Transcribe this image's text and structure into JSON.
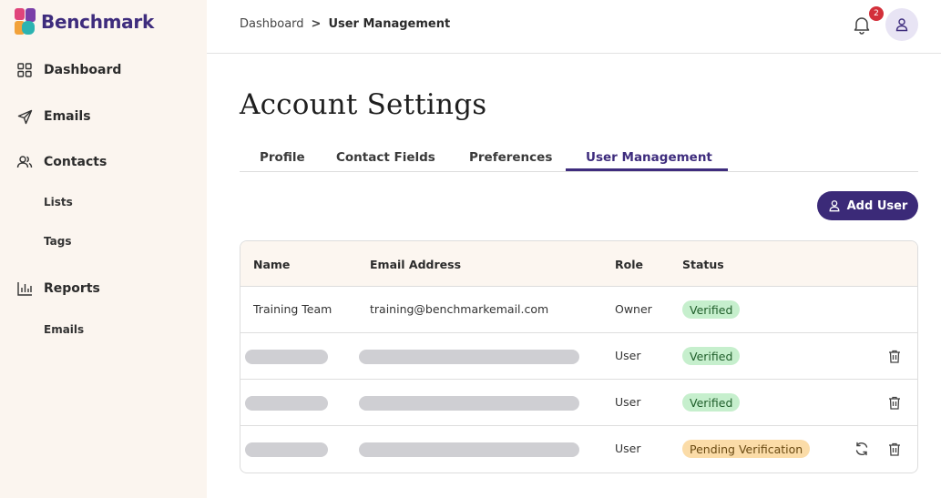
{
  "brand": {
    "name": "Benchmark"
  },
  "sidebar": {
    "items": [
      {
        "label": "Dashboard",
        "icon": "grid-icon"
      },
      {
        "label": "Emails",
        "icon": "send-icon"
      },
      {
        "label": "Contacts",
        "icon": "users-icon"
      },
      {
        "label": "Lists"
      },
      {
        "label": "Tags"
      },
      {
        "label": "Reports",
        "icon": "bar-chart-icon"
      },
      {
        "label": "Emails"
      }
    ]
  },
  "header": {
    "breadcrumb": {
      "parent": "Dashboard",
      "separator": ">",
      "current": "User Management"
    },
    "notifications_count": "2"
  },
  "main": {
    "title": "Account Settings",
    "tabs": [
      {
        "label": "Profile"
      },
      {
        "label": "Contact Fields"
      },
      {
        "label": "Preferences"
      },
      {
        "label": "User Management",
        "active": true
      }
    ],
    "add_user_label": "Add User",
    "table": {
      "columns": [
        "Name",
        "Email Address",
        "Role",
        "Status"
      ],
      "rows": [
        {
          "name": "Training Team",
          "email": "training@benchmarkemail.com",
          "role": "Owner",
          "status": "Verified"
        },
        {
          "name": "",
          "email": "",
          "role": "User",
          "status": "Verified"
        },
        {
          "name": "",
          "email": "",
          "role": "User",
          "status": "Verified"
        },
        {
          "name": "",
          "email": "",
          "role": "User",
          "status": "Pending Verification"
        }
      ]
    }
  },
  "colors": {
    "brand_purple": "#3e2c7d",
    "sidebar_bg": "#fbf5ef",
    "verified_bg": "#c6efcd",
    "pending_bg": "#fbdca8",
    "badge_red": "#d32f3a"
  }
}
